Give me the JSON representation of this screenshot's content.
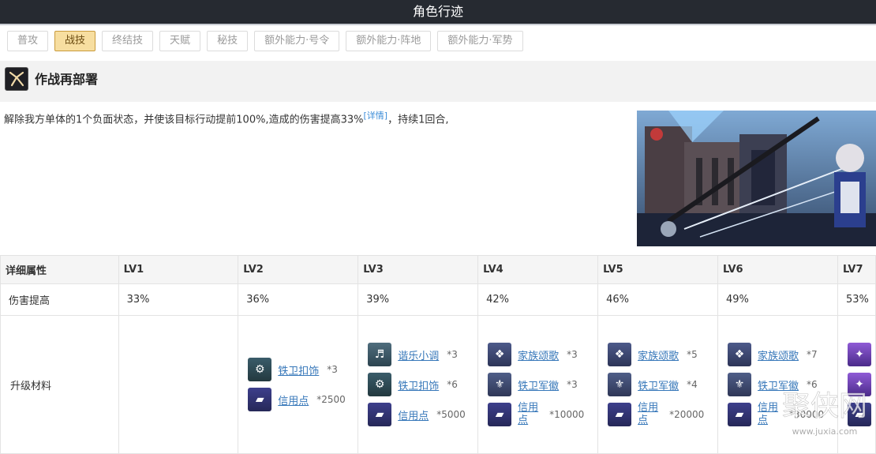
{
  "header": {
    "title": "角色行迹"
  },
  "tabs": [
    {
      "label": "普攻",
      "active": false
    },
    {
      "label": "战技",
      "active": true
    },
    {
      "label": "终结技",
      "active": false
    },
    {
      "label": "天赋",
      "active": false
    },
    {
      "label": "秘技",
      "active": false
    },
    {
      "label": "额外能力·号令",
      "active": false
    },
    {
      "label": "额外能力·阵地",
      "active": false
    },
    {
      "label": "额外能力·军势",
      "active": false
    }
  ],
  "skill": {
    "name": "作战再部署",
    "description": "解除我方单体的1个负面状态，并使该目标行动提前100%,造成的伤害提高33%",
    "detail_link": "[详情]",
    "description_tail": "，持续1回合,"
  },
  "table": {
    "header_label": "详细属性",
    "levels": [
      "LV1",
      "LV2",
      "LV3",
      "LV4",
      "LV5",
      "LV6",
      "LV7"
    ],
    "damage_label": "伤害提高",
    "damage_values": [
      "33%",
      "36%",
      "39%",
      "42%",
      "46%",
      "49%",
      "53%"
    ],
    "materials_label": "升级材料",
    "materials": [
      [],
      [
        {
          "name": "铁卫扣饰",
          "qty": "*3",
          "icon": "ic-guard"
        },
        {
          "name": "信用点",
          "qty": "*2500",
          "icon": "ic-credit"
        }
      ],
      [
        {
          "name": "谐乐小调",
          "qty": "*3",
          "icon": "ic-tune"
        },
        {
          "name": "铁卫扣饰",
          "qty": "*6",
          "icon": "ic-guard"
        },
        {
          "name": "信用点",
          "qty": "*5000",
          "icon": "ic-credit"
        }
      ],
      [
        {
          "name": "家族颂歌",
          "qty": "*3",
          "icon": "ic-ode"
        },
        {
          "name": "铁卫军徽",
          "qty": "*3",
          "icon": "ic-badge"
        },
        {
          "name": "信用点",
          "qty": "*10000",
          "icon": "ic-credit",
          "wrap": true
        }
      ],
      [
        {
          "name": "家族颂歌",
          "qty": "*5",
          "icon": "ic-ode"
        },
        {
          "name": "铁卫军徽",
          "qty": "*4",
          "icon": "ic-badge"
        },
        {
          "name": "信用点",
          "qty": "*20000",
          "icon": "ic-credit",
          "wrap": true
        }
      ],
      [
        {
          "name": "家族颂歌",
          "qty": "*7",
          "icon": "ic-ode"
        },
        {
          "name": "铁卫军徽",
          "qty": "*6",
          "icon": "ic-badge"
        },
        {
          "name": "信用点",
          "qty": "*30000",
          "icon": "ic-credit",
          "wrap": true
        }
      ],
      [
        {
          "name": "",
          "qty": "",
          "icon": "ic-purple"
        },
        {
          "name": "",
          "qty": "",
          "icon": "ic-purple"
        },
        {
          "name": "",
          "qty": "",
          "icon": "ic-credit"
        }
      ]
    ]
  },
  "watermark": {
    "text": "聚侠网",
    "url_text": "www.juxia.com"
  }
}
